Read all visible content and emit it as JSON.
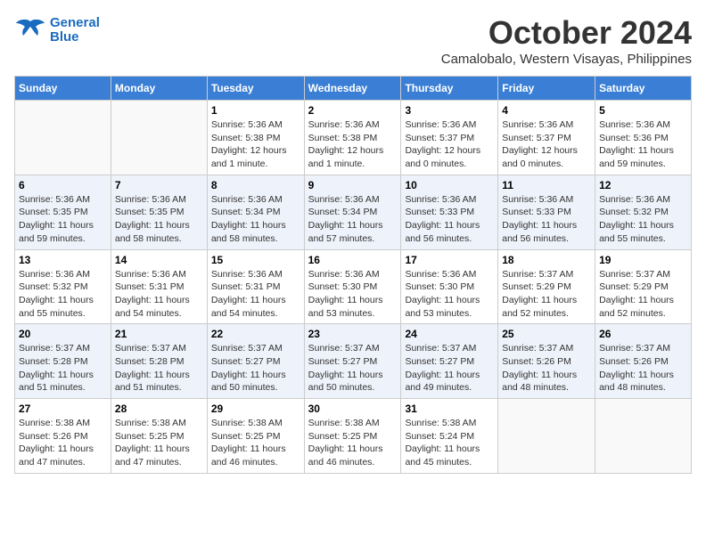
{
  "logo": {
    "line1": "General",
    "line2": "Blue"
  },
  "title": "October 2024",
  "subtitle": "Camalobalo, Western Visayas, Philippines",
  "weekdays": [
    "Sunday",
    "Monday",
    "Tuesday",
    "Wednesday",
    "Thursday",
    "Friday",
    "Saturday"
  ],
  "weeks": [
    [
      {
        "day": "",
        "detail": ""
      },
      {
        "day": "",
        "detail": ""
      },
      {
        "day": "1",
        "detail": "Sunrise: 5:36 AM\nSunset: 5:38 PM\nDaylight: 12 hours\nand 1 minute."
      },
      {
        "day": "2",
        "detail": "Sunrise: 5:36 AM\nSunset: 5:38 PM\nDaylight: 12 hours\nand 1 minute."
      },
      {
        "day": "3",
        "detail": "Sunrise: 5:36 AM\nSunset: 5:37 PM\nDaylight: 12 hours\nand 0 minutes."
      },
      {
        "day": "4",
        "detail": "Sunrise: 5:36 AM\nSunset: 5:37 PM\nDaylight: 12 hours\nand 0 minutes."
      },
      {
        "day": "5",
        "detail": "Sunrise: 5:36 AM\nSunset: 5:36 PM\nDaylight: 11 hours\nand 59 minutes."
      }
    ],
    [
      {
        "day": "6",
        "detail": "Sunrise: 5:36 AM\nSunset: 5:35 PM\nDaylight: 11 hours\nand 59 minutes."
      },
      {
        "day": "7",
        "detail": "Sunrise: 5:36 AM\nSunset: 5:35 PM\nDaylight: 11 hours\nand 58 minutes."
      },
      {
        "day": "8",
        "detail": "Sunrise: 5:36 AM\nSunset: 5:34 PM\nDaylight: 11 hours\nand 58 minutes."
      },
      {
        "day": "9",
        "detail": "Sunrise: 5:36 AM\nSunset: 5:34 PM\nDaylight: 11 hours\nand 57 minutes."
      },
      {
        "day": "10",
        "detail": "Sunrise: 5:36 AM\nSunset: 5:33 PM\nDaylight: 11 hours\nand 56 minutes."
      },
      {
        "day": "11",
        "detail": "Sunrise: 5:36 AM\nSunset: 5:33 PM\nDaylight: 11 hours\nand 56 minutes."
      },
      {
        "day": "12",
        "detail": "Sunrise: 5:36 AM\nSunset: 5:32 PM\nDaylight: 11 hours\nand 55 minutes."
      }
    ],
    [
      {
        "day": "13",
        "detail": "Sunrise: 5:36 AM\nSunset: 5:32 PM\nDaylight: 11 hours\nand 55 minutes."
      },
      {
        "day": "14",
        "detail": "Sunrise: 5:36 AM\nSunset: 5:31 PM\nDaylight: 11 hours\nand 54 minutes."
      },
      {
        "day": "15",
        "detail": "Sunrise: 5:36 AM\nSunset: 5:31 PM\nDaylight: 11 hours\nand 54 minutes."
      },
      {
        "day": "16",
        "detail": "Sunrise: 5:36 AM\nSunset: 5:30 PM\nDaylight: 11 hours\nand 53 minutes."
      },
      {
        "day": "17",
        "detail": "Sunrise: 5:36 AM\nSunset: 5:30 PM\nDaylight: 11 hours\nand 53 minutes."
      },
      {
        "day": "18",
        "detail": "Sunrise: 5:37 AM\nSunset: 5:29 PM\nDaylight: 11 hours\nand 52 minutes."
      },
      {
        "day": "19",
        "detail": "Sunrise: 5:37 AM\nSunset: 5:29 PM\nDaylight: 11 hours\nand 52 minutes."
      }
    ],
    [
      {
        "day": "20",
        "detail": "Sunrise: 5:37 AM\nSunset: 5:28 PM\nDaylight: 11 hours\nand 51 minutes."
      },
      {
        "day": "21",
        "detail": "Sunrise: 5:37 AM\nSunset: 5:28 PM\nDaylight: 11 hours\nand 51 minutes."
      },
      {
        "day": "22",
        "detail": "Sunrise: 5:37 AM\nSunset: 5:27 PM\nDaylight: 11 hours\nand 50 minutes."
      },
      {
        "day": "23",
        "detail": "Sunrise: 5:37 AM\nSunset: 5:27 PM\nDaylight: 11 hours\nand 50 minutes."
      },
      {
        "day": "24",
        "detail": "Sunrise: 5:37 AM\nSunset: 5:27 PM\nDaylight: 11 hours\nand 49 minutes."
      },
      {
        "day": "25",
        "detail": "Sunrise: 5:37 AM\nSunset: 5:26 PM\nDaylight: 11 hours\nand 48 minutes."
      },
      {
        "day": "26",
        "detail": "Sunrise: 5:37 AM\nSunset: 5:26 PM\nDaylight: 11 hours\nand 48 minutes."
      }
    ],
    [
      {
        "day": "27",
        "detail": "Sunrise: 5:38 AM\nSunset: 5:26 PM\nDaylight: 11 hours\nand 47 minutes."
      },
      {
        "day": "28",
        "detail": "Sunrise: 5:38 AM\nSunset: 5:25 PM\nDaylight: 11 hours\nand 47 minutes."
      },
      {
        "day": "29",
        "detail": "Sunrise: 5:38 AM\nSunset: 5:25 PM\nDaylight: 11 hours\nand 46 minutes."
      },
      {
        "day": "30",
        "detail": "Sunrise: 5:38 AM\nSunset: 5:25 PM\nDaylight: 11 hours\nand 46 minutes."
      },
      {
        "day": "31",
        "detail": "Sunrise: 5:38 AM\nSunset: 5:24 PM\nDaylight: 11 hours\nand 45 minutes."
      },
      {
        "day": "",
        "detail": ""
      },
      {
        "day": "",
        "detail": ""
      }
    ]
  ]
}
